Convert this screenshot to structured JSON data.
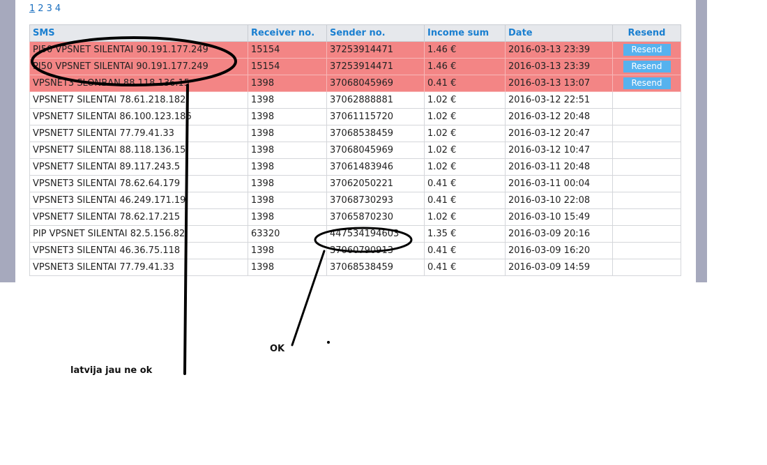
{
  "pagination": {
    "pages": [
      "1",
      "2",
      "3",
      "4"
    ],
    "current": "1"
  },
  "table": {
    "headers": [
      "SMS",
      "Receiver no.",
      "Sender no.",
      "Income sum",
      "Date",
      "Resend"
    ],
    "resend_label": "Resend",
    "rows": [
      {
        "sms": "PI50 VPSNET SILENTAI 90.191.177.249",
        "receiver": "15154",
        "sender": "37253914471",
        "income": "1.46 €",
        "date": "2016-03-13 23:39",
        "error": true
      },
      {
        "sms": "PI50 VPSNET SILENTAI 90.191.177.249",
        "receiver": "15154",
        "sender": "37253914471",
        "income": "1.46 €",
        "date": "2016-03-13 23:39",
        "error": true
      },
      {
        "sms": "VPSNET3 SLONBAN 88.118.136.15",
        "receiver": "1398",
        "sender": "37068045969",
        "income": "0.41 €",
        "date": "2016-03-13 13:07",
        "error": true
      },
      {
        "sms": "VPSNET7 SILENTAI 78.61.218.182",
        "receiver": "1398",
        "sender": "37062888881",
        "income": "1.02 €",
        "date": "2016-03-12 22:51",
        "error": false
      },
      {
        "sms": "VPSNET7 SILENTAI 86.100.123.186",
        "receiver": "1398",
        "sender": "37061115720",
        "income": "1.02 €",
        "date": "2016-03-12 20:48",
        "error": false
      },
      {
        "sms": "VPSNET7 SILENTAI 77.79.41.33",
        "receiver": "1398",
        "sender": "37068538459",
        "income": "1.02 €",
        "date": "2016-03-12 20:47",
        "error": false
      },
      {
        "sms": "VPSNET7 SILENTAI 88.118.136.15",
        "receiver": "1398",
        "sender": "37068045969",
        "income": "1.02 €",
        "date": "2016-03-12 10:47",
        "error": false
      },
      {
        "sms": "VPSNET7 SILENTAI 89.117.243.5",
        "receiver": "1398",
        "sender": "37061483946",
        "income": "1.02 €",
        "date": "2016-03-11 20:48",
        "error": false
      },
      {
        "sms": "VPSNET3 SILENTAI 78.62.64.179",
        "receiver": "1398",
        "sender": "37062050221",
        "income": "0.41 €",
        "date": "2016-03-11 00:04",
        "error": false
      },
      {
        "sms": "VPSNET3 SILENTAI 46.249.171.19",
        "receiver": "1398",
        "sender": "37068730293",
        "income": "0.41 €",
        "date": "2016-03-10 22:08",
        "error": false
      },
      {
        "sms": "VPSNET7 SILENTAI 78.62.17.215",
        "receiver": "1398",
        "sender": "37065870230",
        "income": "1.02 €",
        "date": "2016-03-10 15:49",
        "error": false
      },
      {
        "sms": "PIP VPSNET SILENTAI 82.5.156.82",
        "receiver": "63320",
        "sender": "447534194603",
        "income": "1.35 €",
        "date": "2016-03-09 20:16",
        "error": false
      },
      {
        "sms": "VPSNET3 SILENTAI 46.36.75.118",
        "receiver": "1398",
        "sender": "37060790913",
        "income": "0.41 €",
        "date": "2016-03-09 16:20",
        "error": false
      },
      {
        "sms": "VPSNET3 SILENTAI 77.79.41.33",
        "receiver": "1398",
        "sender": "37068538459",
        "income": "0.41 €",
        "date": "2016-03-09 14:59",
        "error": false
      }
    ]
  },
  "annotations": {
    "ok_label": "OK",
    "latvia_label": "latvija jau ne ok",
    "ink_color": "#000000",
    "error_row_color": "#f38585",
    "button_color": "#56b2ee"
  }
}
